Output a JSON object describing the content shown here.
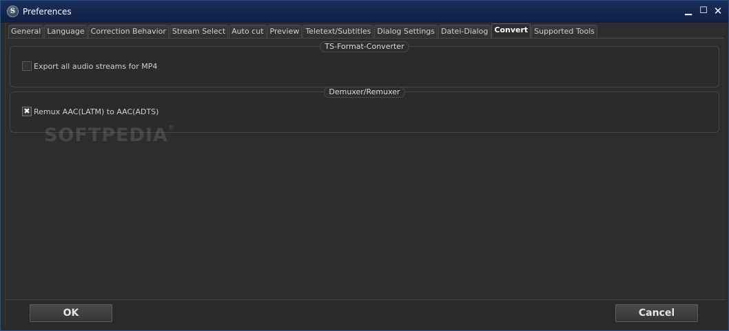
{
  "window": {
    "title": "Preferences",
    "app_icon_letter": "S",
    "minimize_glyph": "▁",
    "maximize_glyph": "☐",
    "close_glyph": "✕"
  },
  "tabs": [
    {
      "label": "General",
      "active": false
    },
    {
      "label": "Language",
      "active": false
    },
    {
      "label": "Correction Behavior",
      "active": false
    },
    {
      "label": "Stream Select",
      "active": false
    },
    {
      "label": "Auto cut",
      "active": false
    },
    {
      "label": "Preview",
      "active": false
    },
    {
      "label": "Teletext/Subtitles",
      "active": false
    },
    {
      "label": "Dialog Settings",
      "active": false
    },
    {
      "label": "Datei-Dialog",
      "active": false
    },
    {
      "label": "Convert",
      "active": true
    },
    {
      "label": "Supported Tools",
      "active": false
    }
  ],
  "convert": {
    "ts_group": {
      "title": "TS-Format-Converter",
      "export_audio": {
        "label": "Export all audio streams for MP4",
        "checked": false
      }
    },
    "demux_group": {
      "title": "Demuxer/Remuxer",
      "remux_aac": {
        "label": "Remux AAC(LATM) to AAC(ADTS)",
        "checked": true
      }
    }
  },
  "watermark": {
    "text": "SOFTPEDIA",
    "mark": "®"
  },
  "buttons": {
    "ok": "OK",
    "cancel": "Cancel"
  },
  "icons": {
    "app": "app-logo-icon",
    "checkmark_glyph": "✖"
  }
}
